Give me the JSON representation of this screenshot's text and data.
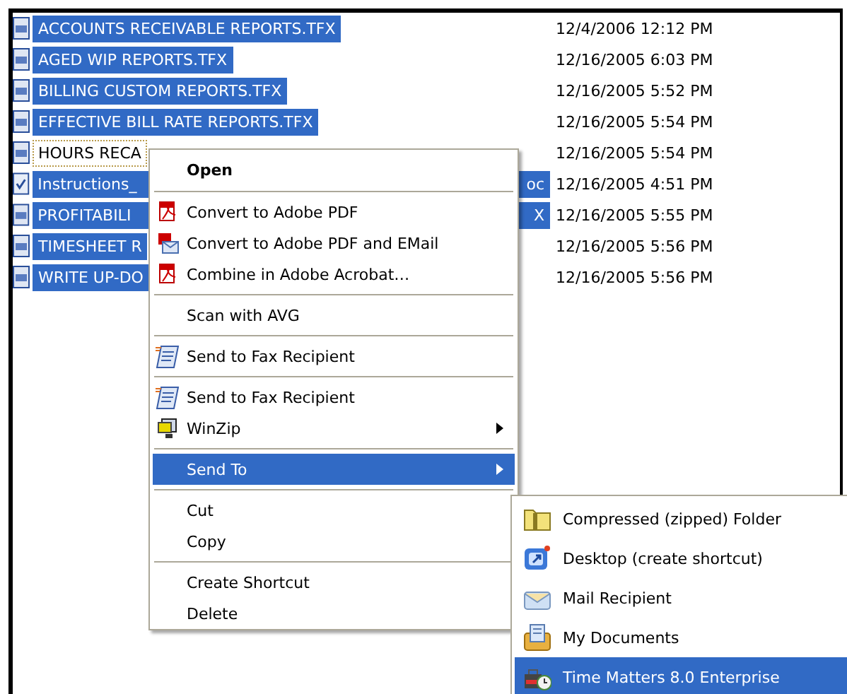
{
  "files": [
    {
      "name": "ACCOUNTS RECEIVABLE REPORTS.TFX",
      "kind": "tfx",
      "date": "12/4/2006 12:12 PM",
      "selected": true,
      "focused": false
    },
    {
      "name": "AGED WIP REPORTS.TFX",
      "kind": "tfx",
      "date": "12/16/2005 6:03 PM",
      "selected": true,
      "focused": false
    },
    {
      "name": "BILLING CUSTOM REPORTS.TFX",
      "kind": "tfx",
      "date": "12/16/2005 5:52 PM",
      "selected": true,
      "focused": false
    },
    {
      "name": "EFFECTIVE BILL RATE REPORTS.TFX",
      "kind": "tfx",
      "date": "12/16/2005 5:54 PM",
      "selected": true,
      "focused": false
    },
    {
      "name": "HOURS RECA",
      "kind": "tfx",
      "date": "12/16/2005 5:54 PM",
      "selected": false,
      "focused": true
    },
    {
      "name": "Instructions_",
      "tail": "oc",
      "kind": "doc",
      "date": "12/16/2005 4:51 PM",
      "selected": true,
      "focused": false
    },
    {
      "name": "PROFITABILI",
      "tail": "X",
      "kind": "tfx",
      "date": "12/16/2005 5:55 PM",
      "selected": true,
      "focused": false
    },
    {
      "name": "TIMESHEET R",
      "kind": "tfx",
      "date": "12/16/2005 5:56 PM",
      "selected": true,
      "focused": false
    },
    {
      "name": "WRITE UP-DO",
      "kind": "tfx",
      "date": "12/16/2005 5:56 PM",
      "selected": true,
      "focused": false
    }
  ],
  "context_menu": [
    {
      "kind": "default",
      "label": "Open",
      "selected": false
    },
    {
      "kind": "separator"
    },
    {
      "kind": "pdf",
      "label": "Convert to Adobe PDF",
      "selected": false
    },
    {
      "kind": "pdf-mail",
      "label": "Convert to Adobe PDF and EMail",
      "selected": false
    },
    {
      "kind": "pdf",
      "label": "Combine in Adobe Acrobat…",
      "selected": false
    },
    {
      "kind": "separator"
    },
    {
      "kind": "command",
      "label": "Scan with AVG",
      "selected": false
    },
    {
      "kind": "separator"
    },
    {
      "kind": "fax",
      "label": "Send to Fax Recipient",
      "selected": false
    },
    {
      "kind": "separator"
    },
    {
      "kind": "fax",
      "label": "Send to Fax Recipient",
      "selected": false
    },
    {
      "kind": "winzip",
      "label": "WinZip",
      "selected": false
    },
    {
      "kind": "separator"
    },
    {
      "kind": "submenu",
      "label": "Send To",
      "selected": true
    },
    {
      "kind": "separator"
    },
    {
      "kind": "command",
      "label": "Cut",
      "selected": false
    },
    {
      "kind": "command",
      "label": "Copy",
      "selected": false
    },
    {
      "kind": "separator"
    },
    {
      "kind": "command",
      "label": "Create Shortcut",
      "selected": false
    },
    {
      "kind": "command",
      "label": "Delete",
      "selected": false
    }
  ],
  "send_to_menu": [
    {
      "label": "Compressed (zipped) Folder",
      "kind": "zip-folder",
      "selected": false
    },
    {
      "label": "Desktop (create shortcut)",
      "kind": "desktop",
      "selected": false
    },
    {
      "label": "Mail Recipient",
      "kind": "mail",
      "selected": false
    },
    {
      "label": "My Documents",
      "kind": "documents",
      "selected": false
    },
    {
      "label": "Time Matters 8.0 Enterprise",
      "kind": "app",
      "selected": true
    }
  ]
}
